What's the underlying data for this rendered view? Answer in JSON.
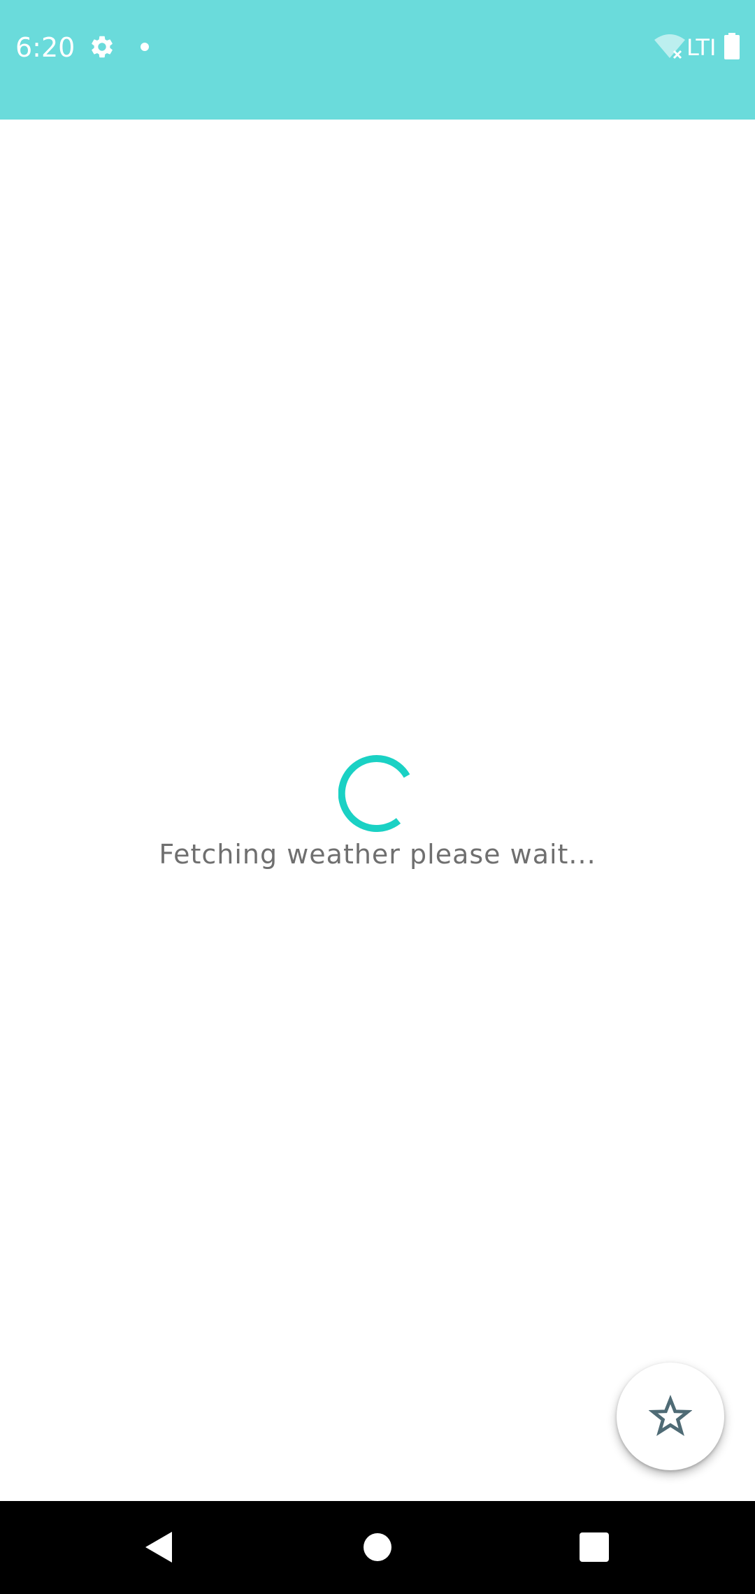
{
  "status_bar": {
    "time": "6:20",
    "network_label": "LTI",
    "background_color": "#6adbdb",
    "icons": [
      "gear-icon",
      "notification-dot-icon",
      "wifi-off-icon",
      "battery-icon"
    ]
  },
  "main": {
    "loading_text": "Fetching weather please wait...",
    "spinner_color": "#1ad1c4"
  },
  "fab": {
    "icon": "star-outline-icon",
    "icon_color": "#4f6b75"
  },
  "nav_bar": {
    "buttons": [
      "back-icon",
      "home-icon",
      "recents-icon"
    ]
  }
}
